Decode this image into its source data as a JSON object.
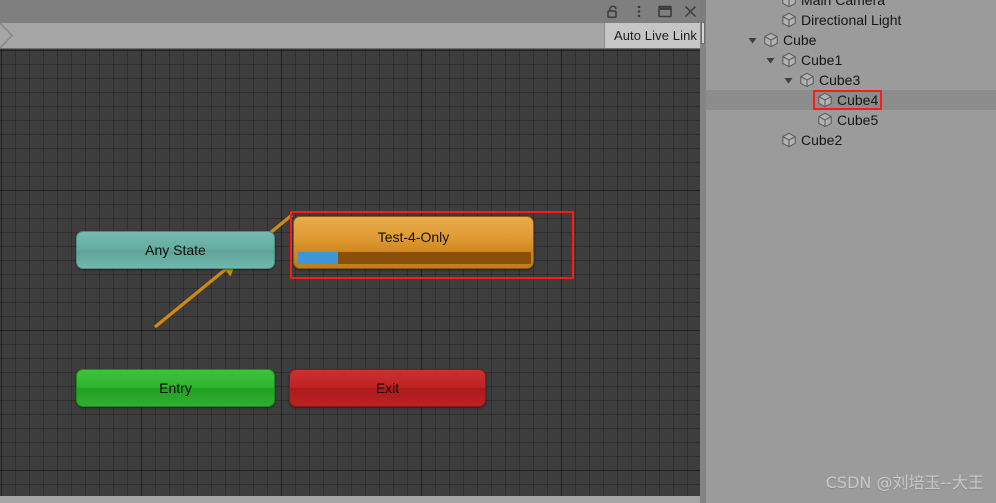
{
  "window": {
    "controls": [
      {
        "name": "lock-icon",
        "label": "Lock"
      },
      {
        "name": "kebab-menu-icon",
        "label": "More"
      },
      {
        "name": "maximize-icon",
        "label": "Maximize"
      },
      {
        "name": "close-icon",
        "label": "Close"
      }
    ]
  },
  "toolbar": {
    "breadcrumb_label": "",
    "auto_live_link_label": "Auto Live Link"
  },
  "graph": {
    "nodes": [
      {
        "id": "any-state",
        "label": "Any State",
        "color": "#65aca1"
      },
      {
        "id": "entry",
        "label": "Entry",
        "color": "#2fb32f"
      },
      {
        "id": "exit",
        "label": "Exit",
        "color": "#bf2424"
      },
      {
        "id": "test-4-only",
        "label": "Test-4-Only",
        "color": "#e09a33",
        "progress": 17,
        "progress_color": "#3e96d4"
      }
    ],
    "transitions": [
      {
        "from": "entry",
        "to": "test-4-only",
        "color": "#cf8b11"
      }
    ],
    "annotation_color": "#ff1a1a"
  },
  "hierarchy": {
    "items": [
      {
        "label": "Main Camera",
        "depth": 1,
        "twisty": "none",
        "selected": false,
        "highlighted": false
      },
      {
        "label": "Directional Light",
        "depth": 1,
        "twisty": "none",
        "selected": false,
        "highlighted": false
      },
      {
        "label": "Cube",
        "depth": 0,
        "twisty": "expanded",
        "selected": false,
        "highlighted": false
      },
      {
        "label": "Cube1",
        "depth": 1,
        "twisty": "expanded",
        "selected": false,
        "highlighted": false
      },
      {
        "label": "Cube3",
        "depth": 2,
        "twisty": "expanded",
        "selected": false,
        "highlighted": false
      },
      {
        "label": "Cube4",
        "depth": 3,
        "twisty": "none",
        "selected": true,
        "highlighted": true
      },
      {
        "label": "Cube5",
        "depth": 3,
        "twisty": "none",
        "selected": false,
        "highlighted": false
      },
      {
        "label": "Cube2",
        "depth": 1,
        "twisty": "none",
        "selected": false,
        "highlighted": false
      }
    ]
  },
  "watermark": {
    "text": "CSDN @刘培玉--大王"
  }
}
